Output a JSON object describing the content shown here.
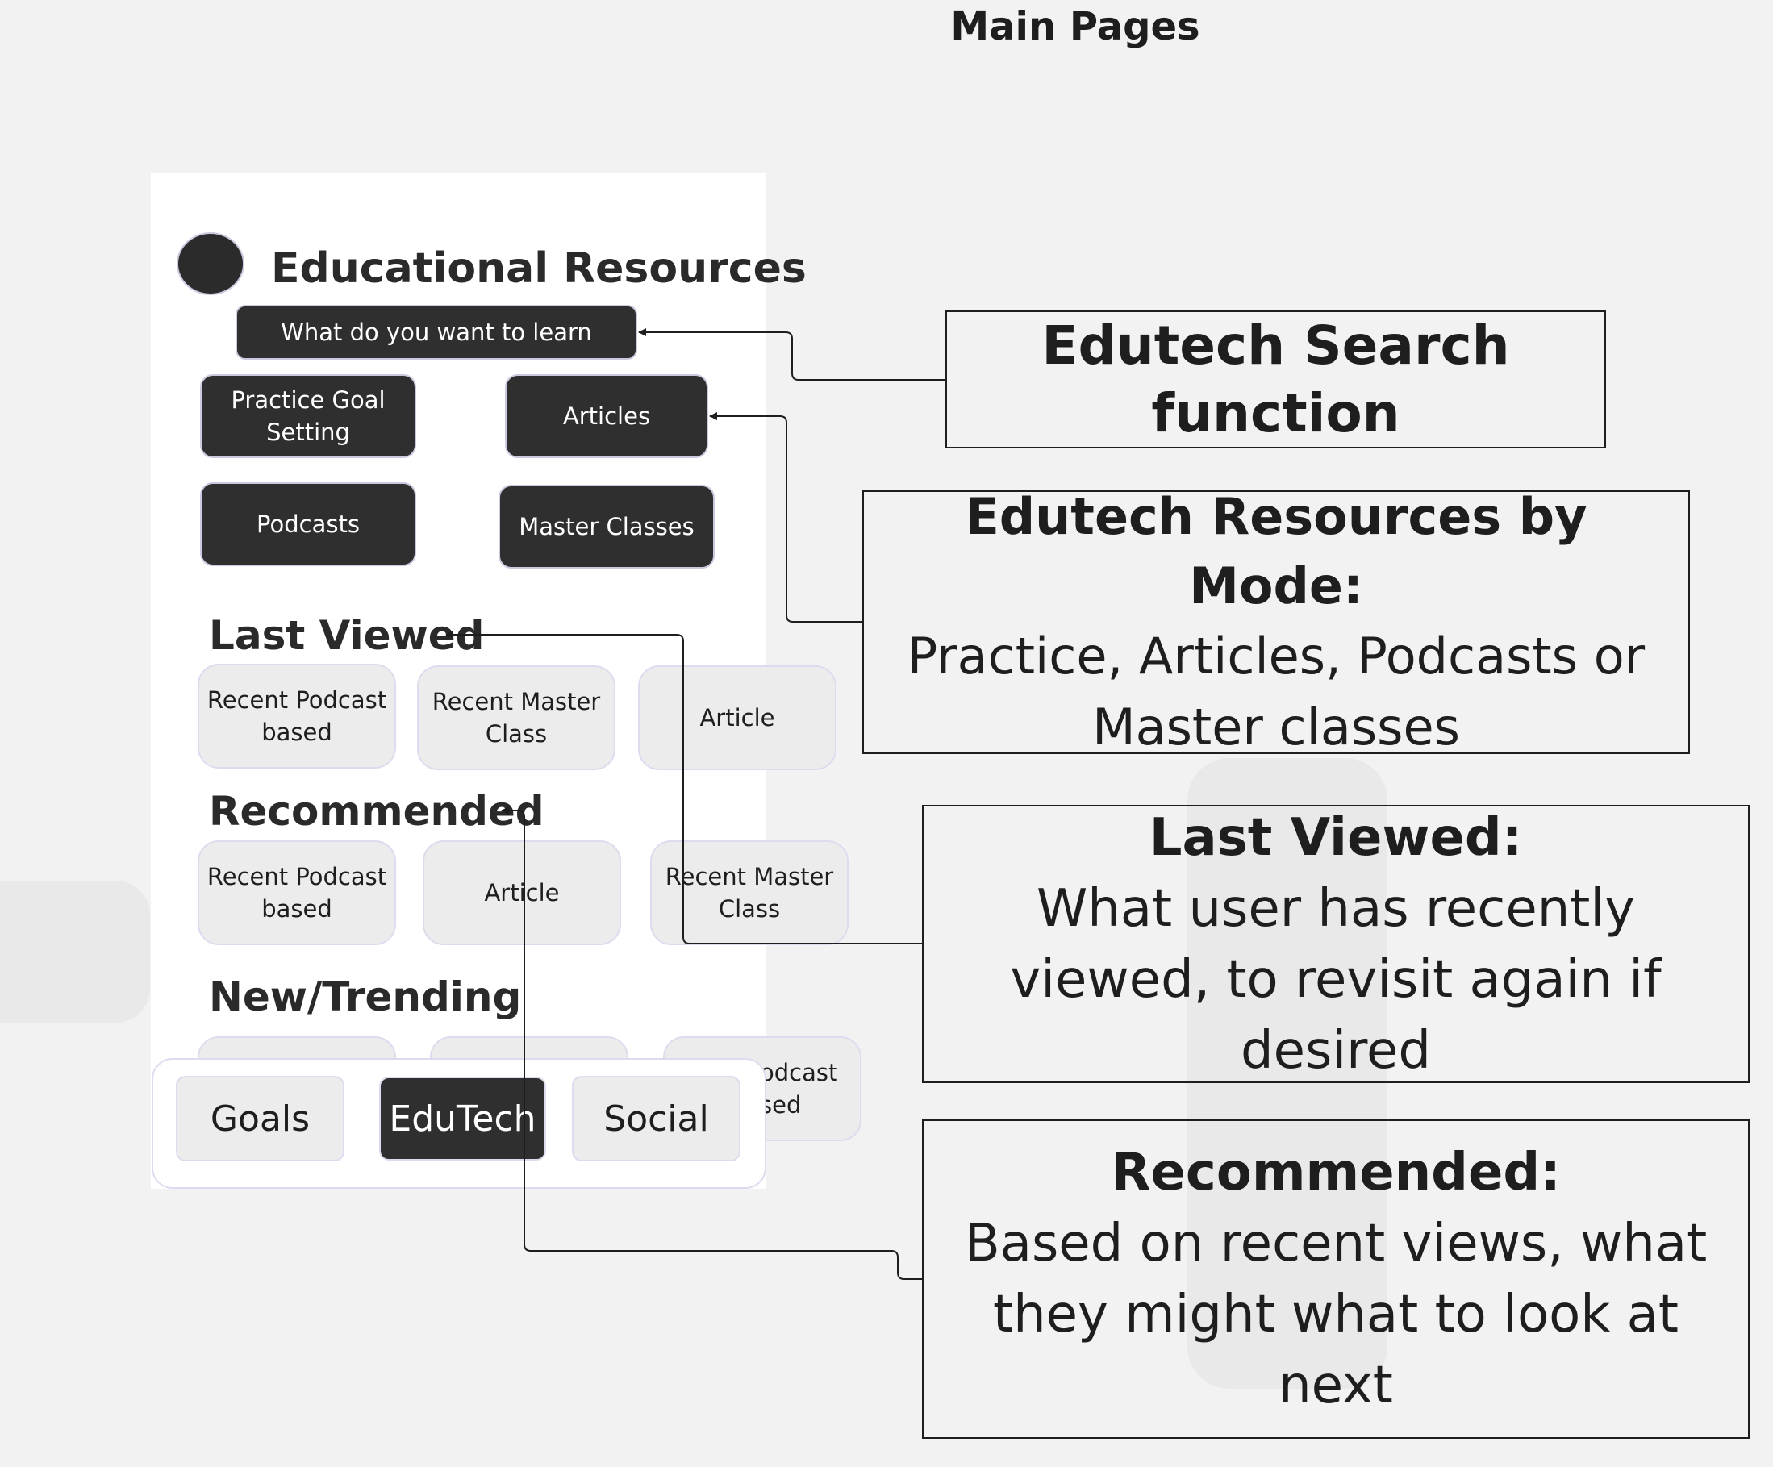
{
  "page_title": "Main Pages",
  "app": {
    "title": "Educational Resources",
    "search_placeholder": "What do you want to learn",
    "modes": [
      {
        "label": "Practice Goal Setting"
      },
      {
        "label": "Articles"
      },
      {
        "label": "Podcasts"
      },
      {
        "label": "Master Classes"
      }
    ],
    "last_viewed": {
      "heading": "Last Viewed",
      "items": [
        "Recent Podcast based",
        "Recent Master Class",
        "Article"
      ]
    },
    "recommended": {
      "heading": "Recommended",
      "items": [
        "Recent Podcast based",
        "Article",
        "Recent Master Class"
      ]
    },
    "new_trending": {
      "heading": "New/Trending",
      "partial_item": "odcast\nsed"
    },
    "nav": [
      {
        "label": "Goals",
        "active": false
      },
      {
        "label": "EduTech",
        "active": true
      },
      {
        "label": "Social",
        "active": false
      }
    ]
  },
  "callouts": {
    "search": {
      "title": "Edutech Search function"
    },
    "modes": {
      "title": "Edutech Resources by Mode:",
      "body": "Practice, Articles, Podcasts or Master classes"
    },
    "last_viewed": {
      "title": "Last Viewed:",
      "body": "What user has recently viewed, to revisit again if desired"
    },
    "recommended": {
      "title": "Recommended:",
      "body": "Based on recent views, what they might what to look at next"
    }
  },
  "colors": {
    "background": "#f2f2f2",
    "dark_button": "#2f2f2f",
    "card": "#ececec",
    "line": "#1e1e1e"
  }
}
